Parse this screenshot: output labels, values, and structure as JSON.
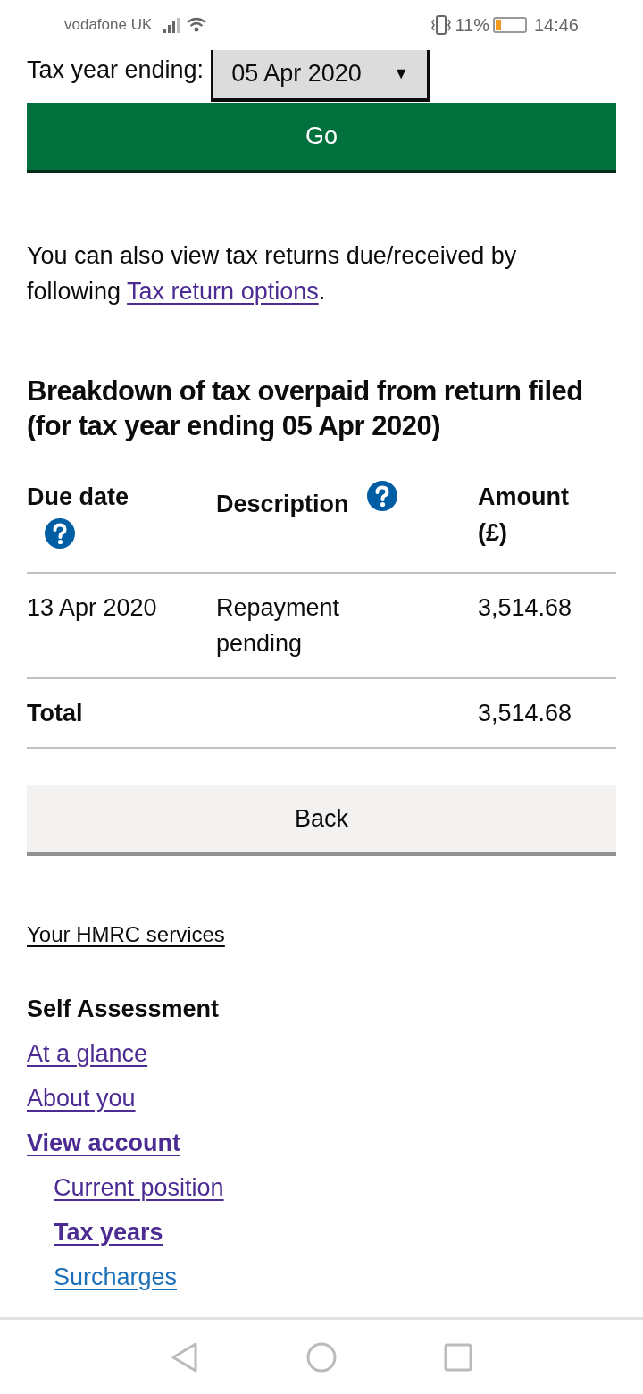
{
  "status_bar": {
    "carrier": "vodafone UK",
    "battery": "11%",
    "time": "14:46"
  },
  "tax_year": {
    "label": "Tax year ending:",
    "value": "05 Apr 2020",
    "caret": "▼"
  },
  "go_button": "Go",
  "intro": {
    "text": "You can also view tax returns due/received by following ",
    "link": "Tax return options",
    "after": "."
  },
  "heading": "Breakdown of tax overpaid from return filed (for tax year ending 05 Apr 2020)",
  "table": {
    "columns": [
      {
        "label": "Due date",
        "help": true
      },
      {
        "label": "Description",
        "help": true
      },
      {
        "label": "Amount (£)",
        "help": false
      }
    ],
    "rows": [
      {
        "cells": [
          "13 Apr 2020",
          "Repayment pending",
          "3,514.68"
        ],
        "total": false
      },
      {
        "cells": [
          "Total",
          "",
          "3,514.68"
        ],
        "total": true
      }
    ]
  },
  "back_button": "Back",
  "services_link": "Your HMRC services",
  "nav": {
    "title": "Self Assessment",
    "items": [
      {
        "label": "At a glance",
        "current": false,
        "visited": true
      },
      {
        "label": "About you",
        "current": false,
        "visited": true
      },
      {
        "label": "View account",
        "current": true,
        "visited": true,
        "children": [
          {
            "label": "Current position",
            "current": false,
            "visited": true
          },
          {
            "label": "Tax years",
            "current": true,
            "visited": true
          },
          {
            "label": "Surcharges",
            "current": false,
            "visited": false
          }
        ]
      }
    ]
  }
}
